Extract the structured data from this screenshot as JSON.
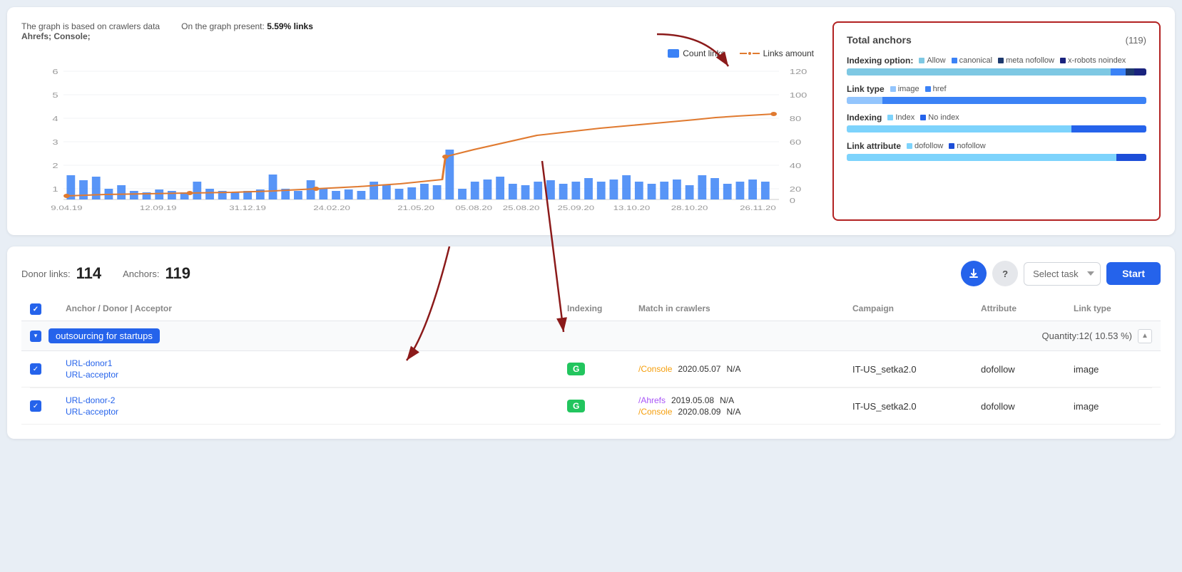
{
  "chart": {
    "meta_left_line1": "The graph is based on crawlers data",
    "meta_left_line2": "Ahrefs; Console;",
    "meta_right_line1": "On the graph present:",
    "meta_right_line2": "5.59% links",
    "legend_count_links": "Count links",
    "legend_links_amount": "Links amount",
    "x_labels": [
      "9.04.19",
      "12.09.19",
      "31.12.19",
      "24.02.20",
      "21.05.20",
      "05.08.20",
      "25.08.20",
      "25.09.20",
      "13.10.20",
      "28.10.20",
      "26.11.20"
    ],
    "y_left_labels": [
      "6",
      "5",
      "4",
      "3",
      "2",
      "1",
      ""
    ],
    "y_right_labels": [
      "120",
      "100",
      "80",
      "60",
      "40",
      "20",
      "0"
    ]
  },
  "total_anchors": {
    "title": "Total anchors",
    "count": "(119)",
    "rows": [
      {
        "label": "Indexing option:",
        "legends": [
          "Allow",
          "canonical",
          "meta nofollow",
          "x-robots noindex"
        ],
        "colors": [
          "#7ec8e3",
          "#3b82f6",
          "#1e3a6e",
          "#1a237e"
        ],
        "segments": [
          88,
          5,
          3,
          4
        ]
      },
      {
        "label": "Link type",
        "legends": [
          "image",
          "href"
        ],
        "colors": [
          "#93c5fd",
          "#3b82f6"
        ],
        "segments": [
          12,
          88
        ]
      },
      {
        "label": "Indexing",
        "legends": [
          "Index",
          "No index"
        ],
        "colors": [
          "#7dd3fc",
          "#2563eb"
        ],
        "segments": [
          75,
          25
        ]
      },
      {
        "label": "Link attribute",
        "legends": [
          "dofollow",
          "nofollow"
        ],
        "colors": [
          "#7dd3fc",
          "#1d4ed8"
        ],
        "segments": [
          90,
          10
        ]
      }
    ]
  },
  "bottom": {
    "donor_links_label": "Donor links:",
    "donor_links_value": "114",
    "anchors_label": "Anchors:",
    "anchors_value": "119",
    "select_task_placeholder": "Select task",
    "start_button": "Start",
    "table_headers": [
      "",
      "Anchor / Donor | Acceptor",
      "Indexing",
      "Match in crawlers",
      "Campaign",
      "Attribute",
      "Link type"
    ],
    "group": {
      "anchor": "outsourcing for startups",
      "quantity": "Quantity:12( 10.53 %)",
      "rows": [
        {
          "url_donor": "URL-donor1",
          "url_acceptor": "URL-acceptor",
          "indexing": "G",
          "crawlers": [
            {
              "source": "/Console",
              "date": "2020.05.07",
              "status": "N/A"
            }
          ],
          "campaign": "IT-US_setka2.0",
          "attribute": "dofollow",
          "link_type": "image"
        },
        {
          "url_donor": "URL-donor-2",
          "url_acceptor": "URL-acceptor",
          "indexing": "G",
          "crawlers": [
            {
              "source": "/Ahrefs",
              "date": "2019.05.08",
              "status": "N/A"
            },
            {
              "source": "/Console",
              "date": "2020.08.09",
              "status": "N/A"
            }
          ],
          "campaign": "IT-US_setka2.0",
          "attribute": "dofollow",
          "link_type": "image"
        }
      ]
    }
  }
}
